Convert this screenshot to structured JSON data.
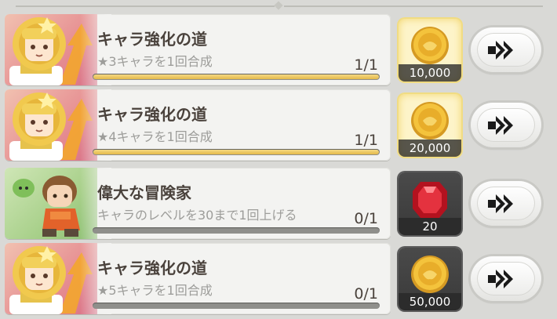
{
  "missions": [
    {
      "title": "キャラ強化の道",
      "description": "★3キャラを1回合成",
      "progress_text": "1/1",
      "progress": 1.0,
      "completed": true,
      "reward": {
        "icon": "gold-coin-icon",
        "amount": "10,000"
      },
      "portrait": "golden-knight-portrait"
    },
    {
      "title": "キャラ強化の道",
      "description": "★4キャラを1回合成",
      "progress_text": "1/1",
      "progress": 1.0,
      "completed": true,
      "reward": {
        "icon": "gold-coin-icon",
        "amount": "20,000"
      },
      "portrait": "golden-knight-portrait"
    },
    {
      "title": "偉大な冒険家",
      "description": "キャラのレベルを30まで1回上げる",
      "progress_text": "0/1",
      "progress": 0.0,
      "completed": false,
      "reward": {
        "icon": "red-gem-icon",
        "amount": "20"
      },
      "portrait": "adventurer-portrait"
    },
    {
      "title": "キャラ強化の道",
      "description": "★5キャラを1回合成",
      "progress_text": "0/1",
      "progress": 0.0,
      "completed": false,
      "reward": {
        "icon": "gold-coin-icon",
        "amount": "50,000"
      },
      "portrait": "golden-knight-portrait"
    }
  ],
  "go_button_icon": "double-chevron-right-icon",
  "colors": {
    "progress_fill": "#e9c35a",
    "title_text": "#4a423c",
    "description_text": "#9d9d9a",
    "reward_highlight": "#fdf4c9"
  }
}
